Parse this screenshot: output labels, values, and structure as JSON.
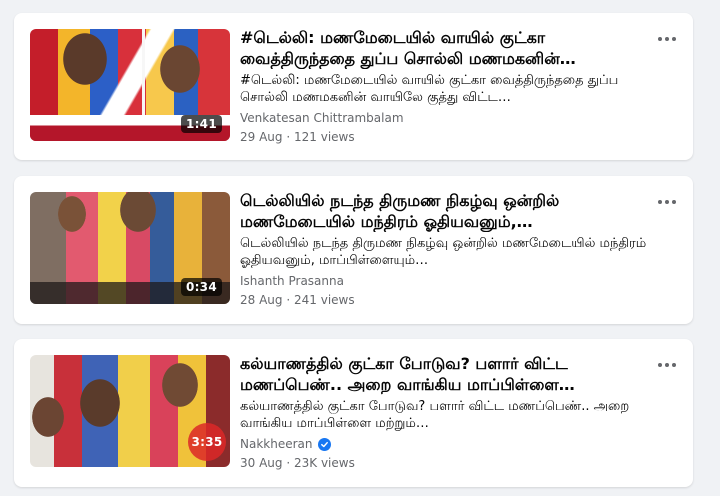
{
  "videos": [
    {
      "title": "#டெல்லி: மணமேடையில் வாயில் குட்கா வைத்திருந்ததை துப்ப சொல்லி மணமகனின்…",
      "description": "#டெல்லி: மணமேடையில் வாயில் குட்கா வைத்திருந்ததை துப்ப சொல்லி மணமகனின் வாயிலே குத்து விட்ட…",
      "channel": "Venkatesan Chittrambalam",
      "verified": false,
      "date": "29 Aug",
      "views": "121 views",
      "duration": "1:41"
    },
    {
      "title": "டெல்லியில் நடந்த திருமண நிகழ்வு ஒன்றில் மணமேடையில் மந்திரம் ஓதியவனும்,…",
      "description": "டெல்லியில் நடந்த திருமண நிகழ்வு ஒன்றில் மணமேடையில் மந்திரம் ஓதியவனும், மாப்பிள்ளையும்…",
      "channel": "Ishanth Prasanna",
      "verified": false,
      "date": "28 Aug",
      "views": "241 views",
      "duration": "0:34"
    },
    {
      "title": "கல்யாணத்தில் குட்கா போடுவ? பளார் விட்ட மணப்பெண்.. அறை வாங்கிய மாப்பிள்ளை…",
      "description": "கல்யாணத்தில் குட்கா போடுவ? பளார் விட்ட மணப்பெண்.. அறை வாங்கிய மாப்பிள்ளை மற்றும்…",
      "channel": "Nakkheeran",
      "verified": true,
      "date": "30 Aug",
      "views": "23K views",
      "duration": "3:35"
    }
  ],
  "meta_separator": "·",
  "icons": {
    "more": "more-horizontal-icon",
    "verified": "verified-badge-icon"
  },
  "colors": {
    "background": "#f0f2f5",
    "card": "#ffffff",
    "secondary_text": "#65676b",
    "verified_blue": "#1877f2"
  }
}
